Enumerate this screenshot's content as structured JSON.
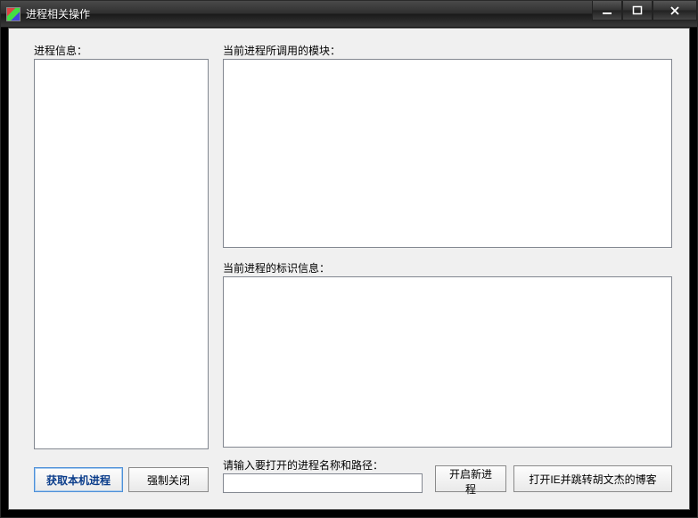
{
  "window": {
    "title": "进程相关操作"
  },
  "labels": {
    "process_info": "进程信息：",
    "current_modules": "当前进程所调用的模块：",
    "current_id_info": "当前进程的标识信息：",
    "input_prompt": "请输入要打开的进程名称和路径："
  },
  "buttons": {
    "get_local_processes": "获取本机进程",
    "force_close": "强制关闭",
    "open_new_process": "开启新进程",
    "open_ie_blog": "打开IE并跳转胡文杰的博客"
  },
  "inputs": {
    "process_path": {
      "value": "",
      "placeholder": ""
    }
  },
  "lists": {
    "processes": [],
    "modules": [],
    "id_info": []
  }
}
